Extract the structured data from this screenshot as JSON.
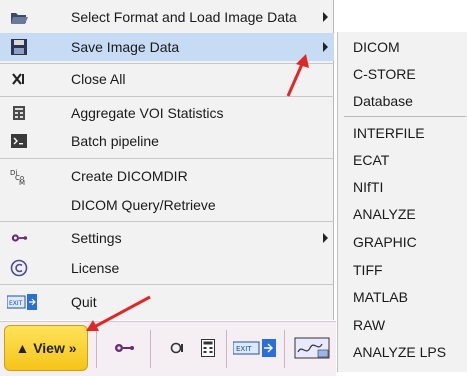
{
  "main_menu": {
    "items": [
      {
        "label": "Select Format and Load Image Data",
        "icon": "folder-open-icon",
        "submenu": true
      },
      {
        "label": "Save Image Data",
        "icon": "floppy-disk-icon",
        "submenu": true,
        "highlighted": true
      },
      {
        "label": "Close All",
        "icon": "close-all-icon",
        "submenu": false
      },
      {
        "label": "Aggregate VOI Statistics",
        "icon": "statistics-icon",
        "submenu": false
      },
      {
        "label": "Batch pipeline",
        "icon": "terminal-icon",
        "submenu": false
      },
      {
        "label": "Create DICOMDIR",
        "icon": "dicomdir-icon",
        "submenu": false
      },
      {
        "label": "DICOM Query/Retrieve",
        "icon": "",
        "submenu": false
      },
      {
        "label": "Settings",
        "icon": "settings-icon",
        "submenu": true
      },
      {
        "label": "License",
        "icon": "copyright-icon",
        "submenu": false
      },
      {
        "label": "Quit",
        "icon": "exit-icon",
        "submenu": false
      }
    ]
  },
  "save_submenu": {
    "items": [
      "DICOM",
      "C-STORE",
      "Database",
      "INTERFILE",
      "ECAT",
      "NIfTI",
      "ANALYZE",
      "GRAPHIC",
      "TIFF",
      "MATLAB",
      "RAW",
      "ANALYZE LPS"
    ]
  },
  "toolbar": {
    "view_label": "▲ View »",
    "icons": [
      "settings-icon",
      "toggle-icon",
      "calculator-icon",
      "exit-icon",
      "display-icon"
    ]
  },
  "colors": {
    "highlight": "#c6dcf5",
    "menu_bg": "#f2f2f2",
    "view_button": "#f6c41a",
    "annotation_arrow": "#e12626"
  }
}
